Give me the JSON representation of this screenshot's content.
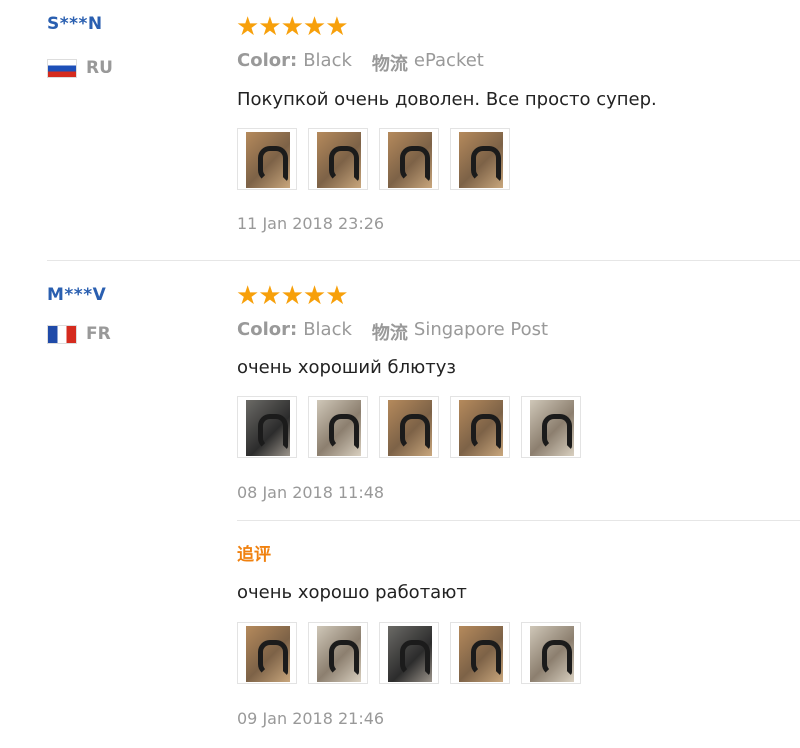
{
  "reviews": [
    {
      "user": "S***N",
      "country": "RU",
      "stars": "★★★★★",
      "color_label": "Color:",
      "color_value": "Black",
      "shipping_label": "物流",
      "shipping_value": "ePacket",
      "text": "Покупкой очень доволен. Все просто супер.",
      "date": "11 Jan 2018 23:26"
    },
    {
      "user": "M***V",
      "country": "FR",
      "stars": "★★★★★",
      "color_label": "Color:",
      "color_value": "Black",
      "shipping_label": "物流",
      "shipping_value": "Singapore Post",
      "text": "очень хороший блютуз",
      "date": "08 Jan 2018 11:48",
      "followup": {
        "label": "追评",
        "text": "очень хорошо работают",
        "date": "09 Jan 2018 21:46"
      }
    }
  ],
  "colors": {
    "star": "#f7a00b",
    "username": "#2a5fb0",
    "followup": "#f0810f"
  }
}
